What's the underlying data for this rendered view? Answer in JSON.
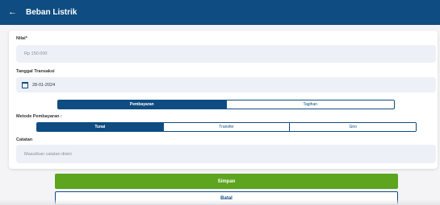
{
  "appbar": {
    "title": "Beban Listrik",
    "back_icon": "arrow-left-icon",
    "color": "#0f4c81"
  },
  "form": {
    "nilai_label": "Nilai*",
    "nilai_value": "Rp 150.000",
    "tanggal_label": "Tanggal Transaksi",
    "tanggal_value": "28-01-2024",
    "calendar_icon": "calendar-icon",
    "type_tabs": [
      {
        "label": "Pembayaran",
        "active": true
      },
      {
        "label": "Tagihan",
        "active": false
      }
    ],
    "metode_label": "Metode Pembayaran :",
    "metode_options": [
      {
        "label": "Tunai",
        "active": true
      },
      {
        "label": "Transfer",
        "active": false
      },
      {
        "label": "Giro",
        "active": false
      }
    ],
    "catatan_label": "Catatan",
    "catatan_placeholder": "Masukkan catatan disini"
  },
  "actions": {
    "save_label": "Simpan",
    "cancel_label": "Batal",
    "save_color": "#5da41f"
  }
}
